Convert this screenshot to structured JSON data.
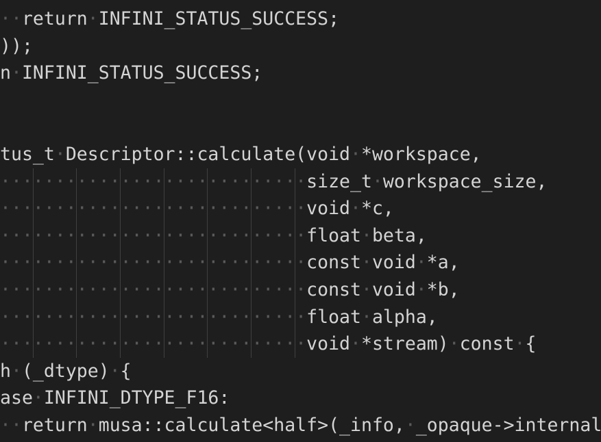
{
  "editor": {
    "lines": [
      {
        "text": "  return INFINI_STATUS_SUCCESS;"
      },
      {
        "text": "));"
      },
      {
        "text": "n INFINI_STATUS_SUCCESS;"
      },
      {
        "text": ""
      },
      {
        "text": ""
      },
      {
        "text": "tus_t Descriptor::calculate(void *workspace,"
      },
      {
        "text": "                            size_t workspace_size,"
      },
      {
        "text": "                            void *c,"
      },
      {
        "text": "                            float beta,"
      },
      {
        "text": "                            const void *a,"
      },
      {
        "text": "                            const void *b,"
      },
      {
        "text": "                            float alpha,"
      },
      {
        "text": "                            void *stream) const {"
      },
      {
        "text": "h (_dtype) {"
      },
      {
        "text": "ase INFINI_DTYPE_F16:"
      },
      {
        "text": "  return musa::calculate<half>(_info, _opaque->internal"
      }
    ],
    "colors": {
      "background": "#1e1e1e",
      "text": "#d4d4d4",
      "whitespace_dot": "#5a5a5a",
      "indent_guide": "#404040"
    }
  }
}
